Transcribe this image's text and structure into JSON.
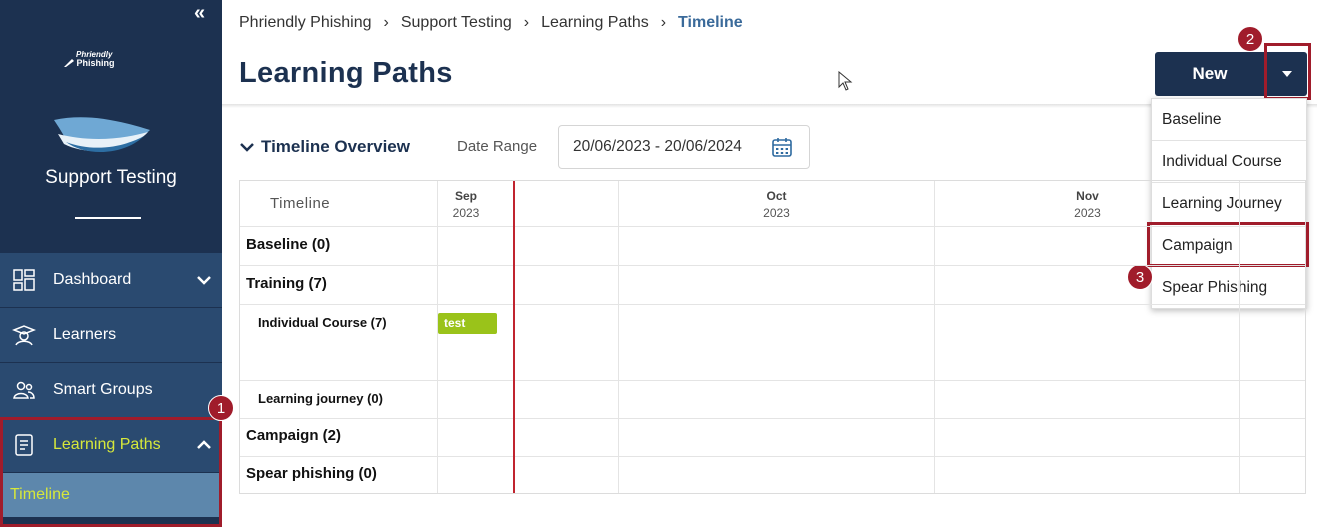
{
  "sidebar": {
    "collapse_icon": "«",
    "logo_top": "Phriendly",
    "logo_bottom": "Phishing",
    "org_name": "Support Testing",
    "items": [
      {
        "label": "Dashboard",
        "icon": "dashboard-icon"
      },
      {
        "label": "Learners",
        "icon": "learners-icon"
      },
      {
        "label": "Smart Groups",
        "icon": "smart-groups-icon"
      },
      {
        "label": "Learning Paths",
        "icon": "learning-paths-icon"
      }
    ],
    "sub_item": "Timeline"
  },
  "breadcrumb": [
    "Phriendly Phishing",
    "Support Testing",
    "Learning Paths",
    "Timeline"
  ],
  "breadcrumb_sep": "›",
  "page_title": "Learning Paths",
  "new_button": "New",
  "new_menu": [
    "Baseline",
    "Individual Course",
    "Learning Journey",
    "Campaign",
    "Spear Phishing"
  ],
  "badges": [
    "1",
    "2",
    "3"
  ],
  "timeline": {
    "toggle_label": "Timeline Overview",
    "date_range_label": "Date Range",
    "date_range_value": "20/06/2023 - 20/06/2024",
    "column_header": "Timeline",
    "months": [
      {
        "name": "Sep",
        "year": "2023"
      },
      {
        "name": "Oct",
        "year": "2023"
      },
      {
        "name": "Nov",
        "year": "2023"
      }
    ],
    "rows": [
      "Baseline (0)",
      "Training (7)",
      "Individual Course (7)",
      "Learning journey (0)",
      "Campaign (2)",
      "Spear phishing (0)"
    ],
    "bar_label": "test"
  },
  "colors": {
    "sidebar": "#1c3150",
    "accent_yellow": "#d7e83a",
    "highlight": "#a01c2b",
    "bar": "#9ac31a",
    "today_line": "#c0242f"
  }
}
